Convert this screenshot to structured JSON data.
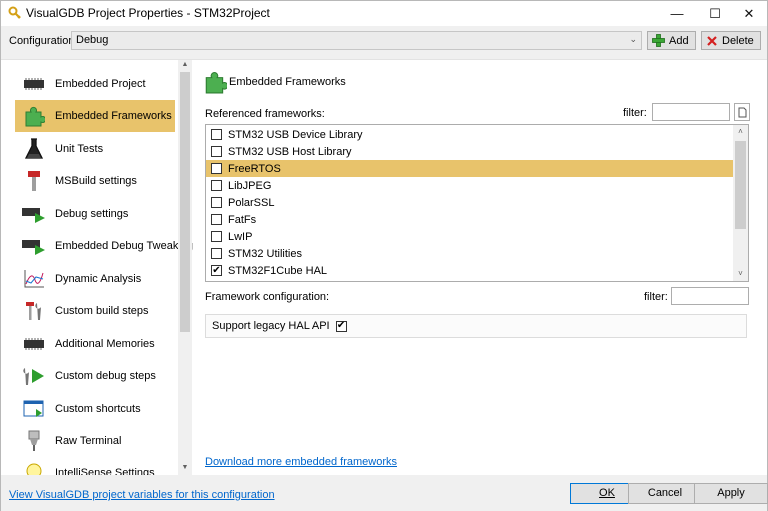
{
  "window": {
    "title": "VisualGDB Project Properties - STM32Project",
    "controls": {
      "minimize": "—",
      "maximize": "☐",
      "close": "✕"
    }
  },
  "config": {
    "label": "Configuration:",
    "selected": "Debug",
    "add_label": "Add",
    "delete_label": "Delete"
  },
  "sidebar": {
    "items": [
      {
        "label": "Embedded Project",
        "icon": "chip-icon"
      },
      {
        "label": "Embedded Frameworks",
        "icon": "puzzle-icon",
        "selected": true
      },
      {
        "label": "Unit Tests",
        "icon": "flask-icon"
      },
      {
        "label": "MSBuild settings",
        "icon": "hammer-icon"
      },
      {
        "label": "Debug settings",
        "icon": "chip-play-icon"
      },
      {
        "label": "Embedded Debug Tweaking",
        "icon": "chip-play-icon"
      },
      {
        "label": "Dynamic Analysis",
        "icon": "chart-icon"
      },
      {
        "label": "Custom build steps",
        "icon": "tools-icon"
      },
      {
        "label": "Additional Memories",
        "icon": "chip-icon"
      },
      {
        "label": "Custom debug steps",
        "icon": "wrench-play-icon"
      },
      {
        "label": "Custom shortcuts",
        "icon": "window-icon"
      },
      {
        "label": "Raw Terminal",
        "icon": "connector-icon"
      },
      {
        "label": "IntelliSense Settings",
        "icon": "bulb-icon"
      }
    ]
  },
  "panel": {
    "title": "Embedded Frameworks",
    "referenced_label": "Referenced frameworks:",
    "filter_label": "filter:",
    "frameworks": [
      {
        "label": "STM32 USB Device Library",
        "checked": false
      },
      {
        "label": "STM32 USB Host Library",
        "checked": false
      },
      {
        "label": "FreeRTOS",
        "checked": false,
        "highlighted": true
      },
      {
        "label": "LibJPEG",
        "checked": false
      },
      {
        "label": "PolarSSL",
        "checked": false
      },
      {
        "label": "FatFs",
        "checked": false
      },
      {
        "label": "LwIP",
        "checked": false
      },
      {
        "label": "STM32 Utilities",
        "checked": false
      },
      {
        "label": "STM32F1Cube HAL",
        "checked": true
      }
    ],
    "config_label": "Framework configuration:",
    "config_filter_label": "filter:",
    "legacy_option": {
      "label": "Support legacy HAL API",
      "checked": true
    },
    "download_link": "Download more embedded frameworks"
  },
  "footer": {
    "variables_link": "View VisualGDB project variables for this configuration",
    "ok_label": "OK",
    "cancel_label": "Cancel",
    "apply_label": "Apply"
  },
  "colors": {
    "selection": "#e8c36b",
    "link": "#0066cc",
    "default_button_border": "#0078d7"
  }
}
